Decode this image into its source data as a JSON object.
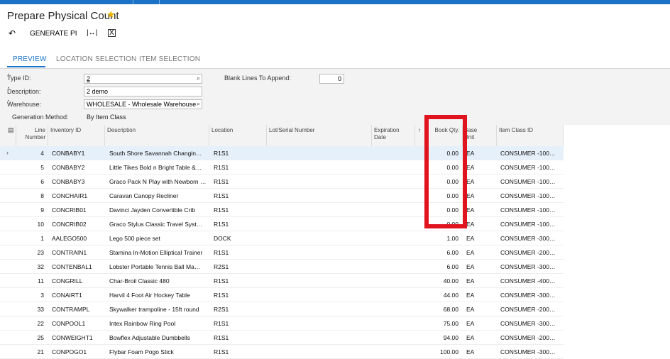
{
  "header": {
    "title": "Prepare Physical Count"
  },
  "toolbar": {
    "undo_icon": "undo-icon",
    "generate_label": "GENERATE PI",
    "fit_icon": "fit-columns-icon",
    "excel_icon": "export-excel-icon"
  },
  "tabs": [
    {
      "label": "PREVIEW",
      "active": true
    },
    {
      "label": "LOCATION SELECTION",
      "active": false
    },
    {
      "label": "ITEM SELECTION",
      "active": false
    }
  ],
  "form": {
    "type_id_label": "Type ID:",
    "type_id_value": "2",
    "description_label": "Description:",
    "description_value": "2 demo",
    "warehouse_label": "Warehouse:",
    "warehouse_value": "WHOLESALE - Wholesale Warehouse",
    "generation_method_label": "Generation Method:",
    "generation_method_value": "By Item Class",
    "blank_lines_label": "Blank Lines To Append:",
    "blank_lines_value": "0"
  },
  "grid": {
    "columns": {
      "line_number": "Line Number",
      "inventory_id": "Inventory ID",
      "description": "Description",
      "location": "Location",
      "lot_serial": "Lot/Serial Number",
      "expiration": "Expiration Date",
      "book_qty": "Book Qty.",
      "base_unit": "Base Unit",
      "item_class": "Item Class ID"
    },
    "rows": [
      {
        "line": "4",
        "inv": "CONBABY1",
        "desc": "South Shore Savannah Changin…",
        "loc": "R1S1",
        "qty": "0.00",
        "unit": "EA",
        "cls": "CONSUMER -100…"
      },
      {
        "line": "5",
        "inv": "CONBABY2",
        "desc": "Little Tikes Bold n Bright Table &…",
        "loc": "R1S1",
        "qty": "0.00",
        "unit": "EA",
        "cls": "CONSUMER -100…"
      },
      {
        "line": "6",
        "inv": "CONBABY3",
        "desc": "Graco Pack N Play with Newborn …",
        "loc": "R1S1",
        "qty": "0.00",
        "unit": "EA",
        "cls": "CONSUMER -100…"
      },
      {
        "line": "8",
        "inv": "CONCHAIR1",
        "desc": "Caravan Canopy Recliner",
        "loc": "R1S1",
        "qty": "0.00",
        "unit": "EA",
        "cls": "CONSUMER -100…"
      },
      {
        "line": "9",
        "inv": "CONCRIB01",
        "desc": "Davinci Jayden Convertible Crib",
        "loc": "R1S1",
        "qty": "0.00",
        "unit": "EA",
        "cls": "CONSUMER -100…"
      },
      {
        "line": "10",
        "inv": "CONCRIB02",
        "desc": "Graco Stylus Classic Travel Syst…",
        "loc": "R1S1",
        "qty": "0.00",
        "unit": "EA",
        "cls": "CONSUMER -100…"
      },
      {
        "line": "1",
        "inv": "AALEGO500",
        "desc": "Lego 500 piece set",
        "loc": "DOCK",
        "qty": "1.00",
        "unit": "EA",
        "cls": "CONSUMER -300…"
      },
      {
        "line": "23",
        "inv": "CONTRAIN1",
        "desc": "Stamina In-Motion Elliptical Trainer",
        "loc": "R1S1",
        "qty": "6.00",
        "unit": "EA",
        "cls": "CONSUMER -200…"
      },
      {
        "line": "32",
        "inv": "CONTENBAL1",
        "desc": "Lobster Portable Tennis Ball Ma…",
        "loc": "R2S1",
        "qty": "6.00",
        "unit": "EA",
        "cls": "CONSUMER -300…"
      },
      {
        "line": "11",
        "inv": "CONGRILL",
        "desc": "Char-Broil Classic 480",
        "loc": "R1S1",
        "qty": "40.00",
        "unit": "EA",
        "cls": "CONSUMER -400…"
      },
      {
        "line": "3",
        "inv": "CONAIRT1",
        "desc": "Harvil 4 Foot Air Hockey Table",
        "loc": "R1S1",
        "qty": "44.00",
        "unit": "EA",
        "cls": "CONSUMER -300…"
      },
      {
        "line": "33",
        "inv": "CONTRAMPL",
        "desc": "Skywalker trampoline - 15ft round",
        "loc": "R2S1",
        "qty": "68.00",
        "unit": "EA",
        "cls": "CONSUMER -200…"
      },
      {
        "line": "22",
        "inv": "CONPOOL1",
        "desc": "Intex Rainbow Ring Pool",
        "loc": "R1S1",
        "qty": "75.00",
        "unit": "EA",
        "cls": "CONSUMER -300…"
      },
      {
        "line": "25",
        "inv": "CONWEIGHT1",
        "desc": "Bowflex Adjustable Dumbbells",
        "loc": "R1S1",
        "qty": "94.00",
        "unit": "EA",
        "cls": "CONSUMER -200…"
      },
      {
        "line": "21",
        "inv": "CONPOGO1",
        "desc": "Flybar Foam Pogo Stick",
        "loc": "R1S1",
        "qty": "100.00",
        "unit": "EA",
        "cls": "CONSUMER -300…"
      }
    ]
  },
  "colors": {
    "accent": "#1a73c7",
    "highlight": "#e0141e",
    "star": "#f0b400"
  }
}
